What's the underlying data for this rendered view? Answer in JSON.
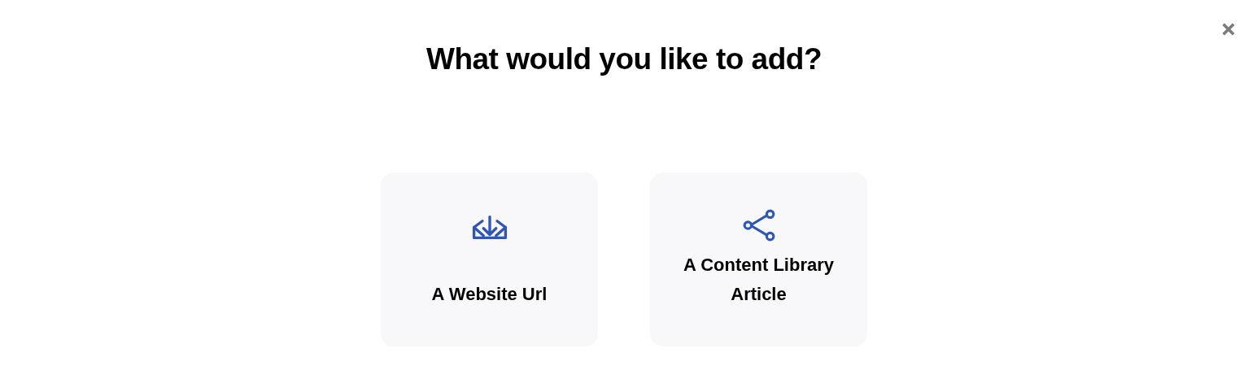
{
  "dialog": {
    "title": "What would you like to add?",
    "close": true
  },
  "options": [
    {
      "kind": "download",
      "label": "A Website Url"
    },
    {
      "kind": "share",
      "label": "A Content Library Article"
    }
  ]
}
